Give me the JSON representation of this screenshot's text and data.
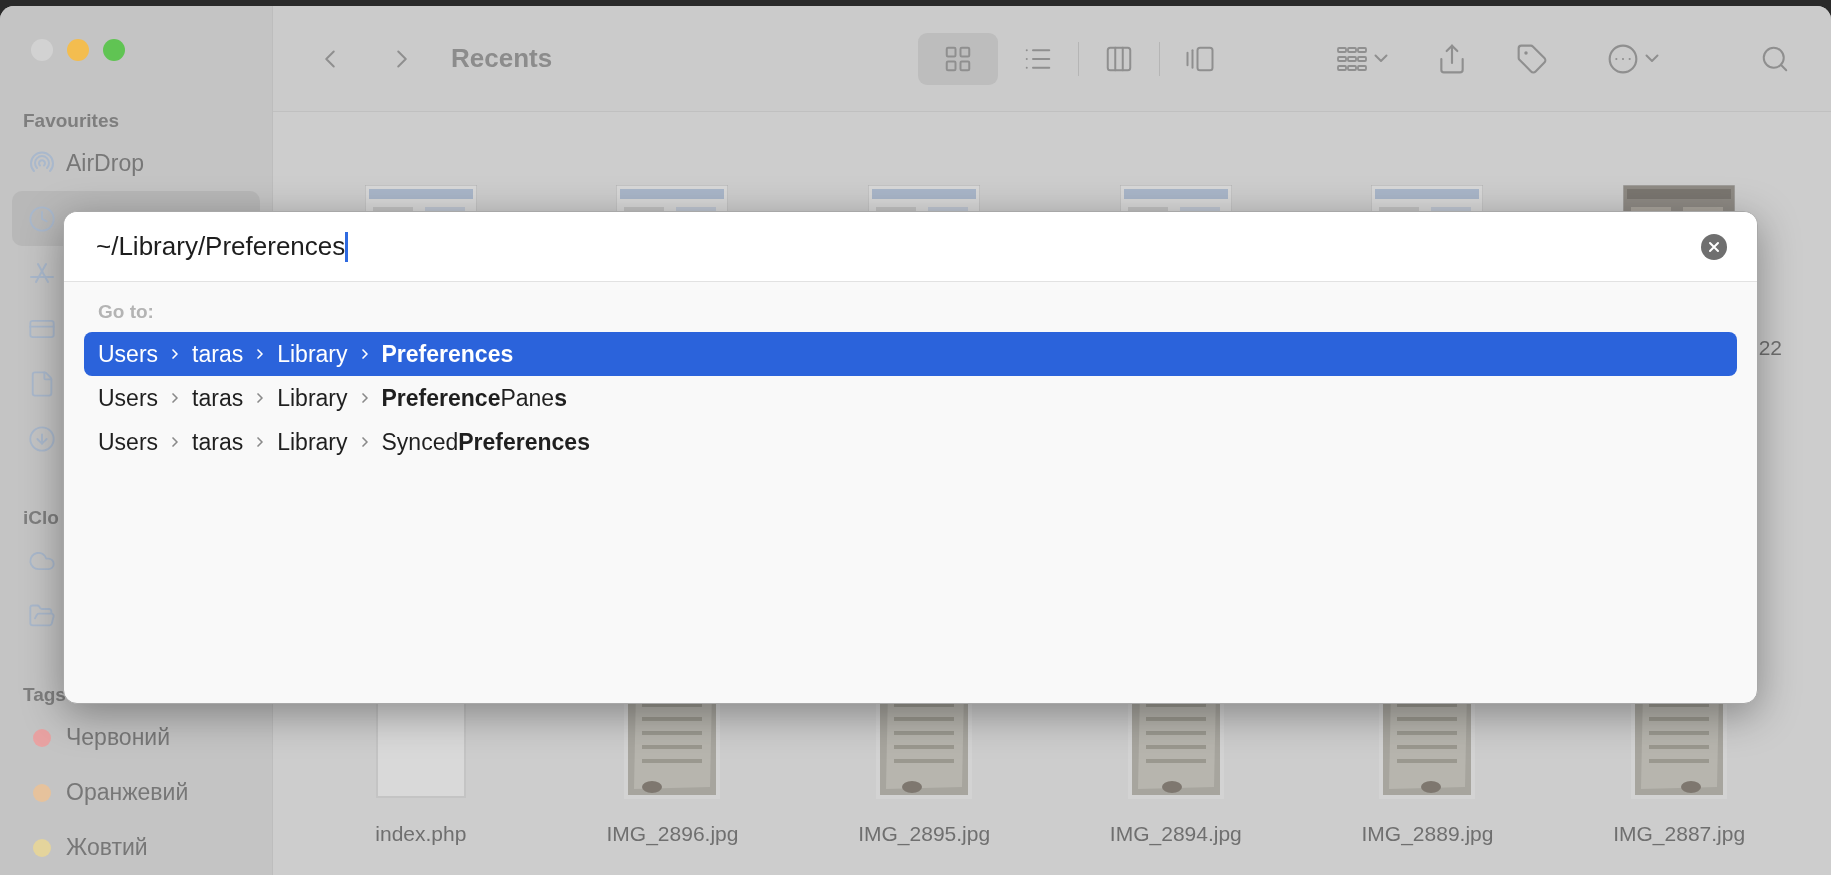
{
  "window": {
    "traffic_lights": [
      {
        "color": "#d2d2d2"
      },
      {
        "color": "#f3bd4f"
      },
      {
        "color": "#60c453"
      }
    ]
  },
  "toolbar": {
    "title": "Recents",
    "views": [
      {
        "kind": "icons",
        "selected": true
      },
      {
        "kind": "list",
        "selected": false
      },
      {
        "kind": "columns",
        "selected": false
      },
      {
        "kind": "gallery",
        "selected": false
      }
    ]
  },
  "sidebar": {
    "sections": [
      {
        "title": "Favourites",
        "items": [
          {
            "kind": "airdrop",
            "label": "AirDrop",
            "selected": false
          },
          {
            "kind": "clock",
            "selected": true
          },
          {
            "kind": "apps",
            "selected": false
          },
          {
            "kind": "desktop",
            "selected": false
          },
          {
            "kind": "document",
            "selected": false
          },
          {
            "kind": "download",
            "selected": false
          }
        ]
      },
      {
        "title": "iClo",
        "items": [
          {
            "kind": "cloud",
            "selected": false
          },
          {
            "kind": "shared-folder",
            "selected": false
          }
        ]
      },
      {
        "title": "Tags",
        "items": [
          {
            "kind": "tag",
            "label": "Червоний",
            "color": "#e8a2a2",
            "selected": false
          },
          {
            "kind": "tag",
            "label": "Оранжевий",
            "color": "#e6c29c",
            "selected": false
          },
          {
            "kind": "tag",
            "label": "Жовтий",
            "color": "#e4d49c",
            "selected": false
          }
        ]
      }
    ]
  },
  "files": {
    "rows": [
      [
        {
          "kind": "picture"
        },
        {
          "kind": "picture"
        },
        {
          "kind": "picture"
        },
        {
          "kind": "picture"
        },
        {
          "kind": "picture"
        },
        {
          "kind": "picture",
          "label": "22"
        }
      ],
      [
        {
          "kind": "document",
          "label": "index.php"
        },
        {
          "kind": "picture",
          "label": "IMG_2896.jpg"
        },
        {
          "kind": "picture",
          "label": "IMG_2895.jpg"
        },
        {
          "kind": "picture",
          "label": "IMG_2894.jpg"
        },
        {
          "kind": "picture",
          "label": "IMG_2889.jpg"
        },
        {
          "kind": "picture",
          "label": "IMG_2887.jpg"
        }
      ]
    ]
  },
  "dialog": {
    "path_field": {
      "value": "~/Library/Preferences"
    },
    "goto_label": "Go to:",
    "suggestions": [
      {
        "selected": true,
        "path": [
          "Users",
          "taras",
          "Library",
          "**Preferences**"
        ]
      },
      {
        "selected": false,
        "path": [
          "Users",
          "taras",
          "Library",
          "**Preference**Pane**s**"
        ]
      },
      {
        "selected": false,
        "path": [
          "Users",
          "taras",
          "Library",
          "Synced**Preferences**"
        ]
      }
    ]
  }
}
